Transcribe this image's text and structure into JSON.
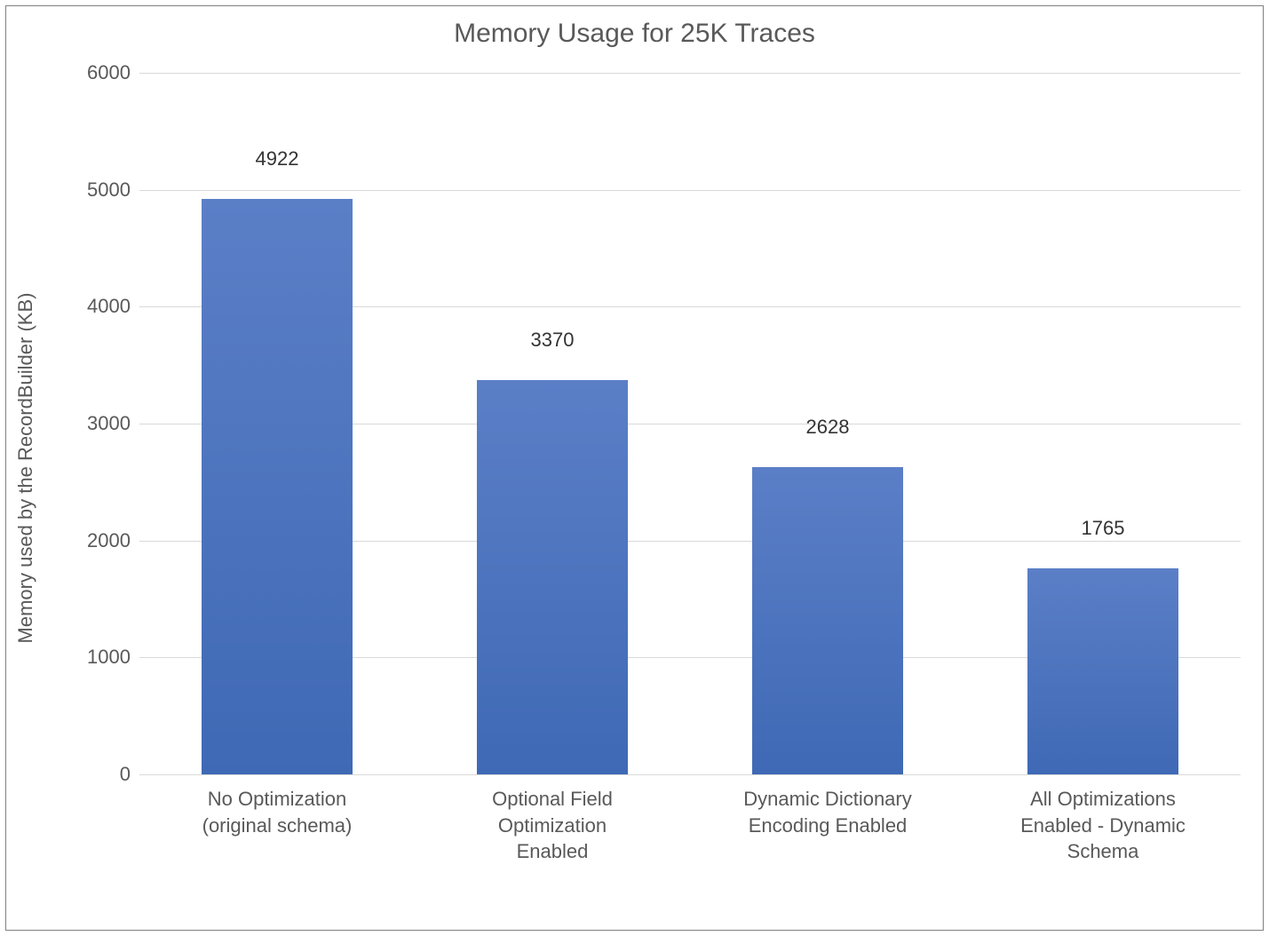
{
  "chart_data": {
    "type": "bar",
    "title": "Memory Usage for 25K Traces",
    "ylabel": "Memory used by the RecordBuilder (KB)",
    "xlabel": "",
    "ylim": [
      0,
      6000
    ],
    "y_ticks": [
      0,
      1000,
      2000,
      3000,
      4000,
      5000,
      6000
    ],
    "categories": [
      "No Optimization (original schema)",
      "Optional Field Optimization Enabled",
      "Dynamic Dictionary Encoding Enabled",
      "All Optimizations Enabled - Dynamic Schema"
    ],
    "values": [
      4922,
      3370,
      2628,
      1765
    ]
  },
  "layout": {
    "bar_color_top": "#5b7fc7",
    "bar_color_bottom": "#3f69b5",
    "category_labels": [
      [
        "No Optimization",
        "(original schema)"
      ],
      [
        "Optional Field",
        "Optimization",
        "Enabled"
      ],
      [
        "Dynamic Dictionary",
        "Encoding Enabled"
      ],
      [
        "All Optimizations",
        "Enabled - Dynamic",
        "Schema"
      ]
    ]
  }
}
